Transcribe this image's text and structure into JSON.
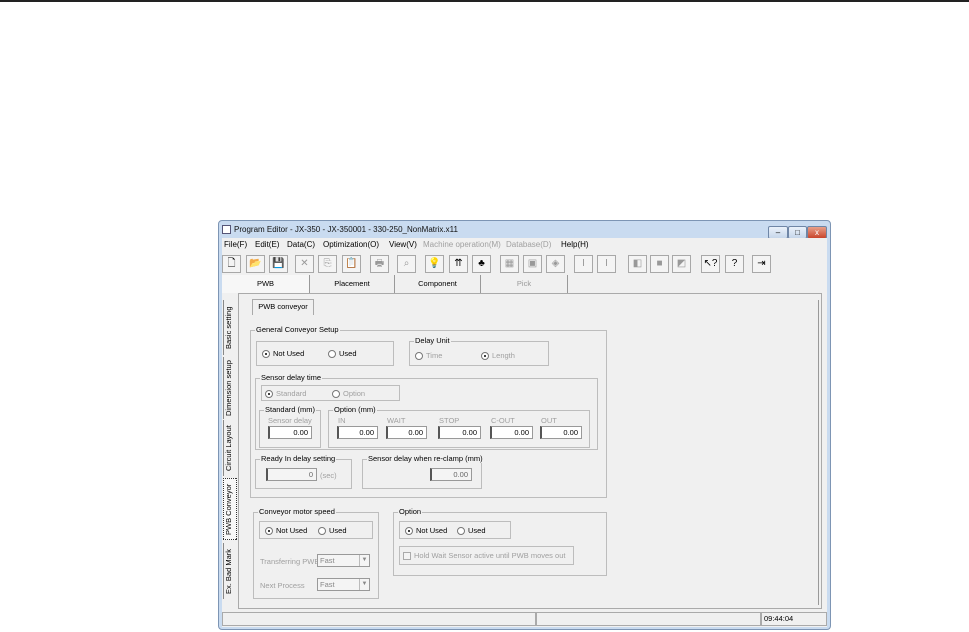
{
  "window": {
    "title": "Program Editor - JX-350 - JX-350001 - 330-250_NonMatrix.x11",
    "minimize": "–",
    "maximize": "□",
    "close": "x"
  },
  "menu": [
    "File(F)",
    "Edit(E)",
    "Data(C)",
    "Optimization(O)",
    "View(V)",
    "Machine operation(M)",
    "Database(D)",
    "Help(H)"
  ],
  "menu_disabled": [
    false,
    false,
    false,
    false,
    false,
    true,
    true,
    false
  ],
  "toolbar": [
    {
      "name": "new-icon",
      "glyph": "🗋"
    },
    {
      "name": "open-icon",
      "glyph": "📂"
    },
    {
      "name": "save-icon",
      "glyph": "💾"
    },
    {
      "name": "cut-icon",
      "glyph": "✕"
    },
    {
      "name": "copy-icon",
      "glyph": "⎘"
    },
    {
      "name": "paste-icon",
      "glyph": "📋"
    },
    {
      "name": "print-icon",
      "glyph": "🖶"
    },
    {
      "name": "find-icon",
      "glyph": "⌕"
    },
    {
      "name": "idea-icon",
      "glyph": "💡"
    },
    {
      "name": "optimize-icon",
      "glyph": "⇈"
    },
    {
      "name": "shapes-icon",
      "glyph": "♣"
    },
    {
      "name": "machine1-icon",
      "glyph": "▦"
    },
    {
      "name": "machine2-icon",
      "glyph": "▣"
    },
    {
      "name": "machine3-icon",
      "glyph": "◈"
    },
    {
      "name": "align1-icon",
      "glyph": "I"
    },
    {
      "name": "align2-icon",
      "glyph": "I"
    },
    {
      "name": "tool1-icon",
      "glyph": "◧"
    },
    {
      "name": "tool2-icon",
      "glyph": "■"
    },
    {
      "name": "tool3-icon",
      "glyph": "◩"
    },
    {
      "name": "context-help-icon",
      "glyph": "↖?"
    },
    {
      "name": "help-icon",
      "glyph": "?"
    },
    {
      "name": "exit-icon",
      "glyph": "⇥"
    }
  ],
  "tabs": [
    {
      "label": "PWB"
    },
    {
      "label": "Placement"
    },
    {
      "label": "Component"
    },
    {
      "label": "Pick"
    }
  ],
  "subtab": "PWB conveyor",
  "side_tabs": [
    "Basic setting",
    "Dimension setup",
    "Circuit Layout",
    "PWB Conveyor",
    "Ex. Bad Mark"
  ],
  "general": {
    "title": "General Conveyor Setup",
    "not_used": "Not Used",
    "used": "Used"
  },
  "delay_unit": {
    "title": "Delay Unit",
    "time": "Time",
    "length": "Length"
  },
  "sensor_delay": {
    "title": "Sensor delay time",
    "standard": "Standard",
    "option": "Option",
    "std_group": "Standard (mm)",
    "std_label": "Sensor delay",
    "std_value": "0.00",
    "opt_group": "Option (mm)",
    "opt_labels": [
      "IN",
      "WAIT",
      "STOP",
      "C-OUT",
      "OUT"
    ],
    "opt_values": [
      "0.00",
      "0.00",
      "0.00",
      "0.00",
      "0.00"
    ]
  },
  "ready": {
    "title": "Ready In delay setting",
    "value": "0",
    "unit": "(sec)"
  },
  "reclamp": {
    "title": "Sensor delay when re-clamp (mm)",
    "value": "0.00"
  },
  "motor": {
    "title": "Conveyor motor speed",
    "not_used": "Not Used",
    "used": "Used",
    "transferring_label": "Transferring PWB",
    "transferring_value": "Fast",
    "next_label": "Next Process",
    "next_value": "Fast"
  },
  "option": {
    "title": "Option",
    "not_used": "Not Used",
    "used": "Used",
    "hold_label": "Hold Wait Sensor active until PWB moves out"
  },
  "status": {
    "time": "09:44:04"
  }
}
